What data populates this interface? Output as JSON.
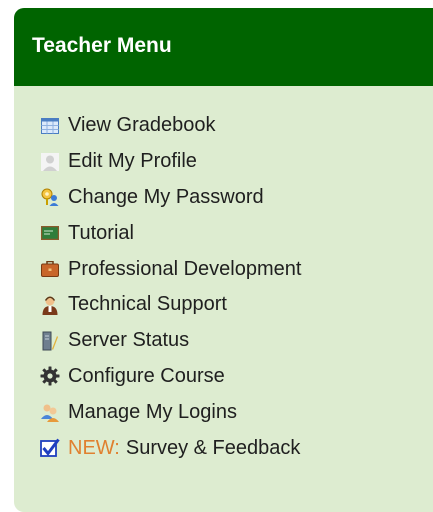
{
  "menu": {
    "title": "Teacher Menu",
    "items": [
      {
        "label": "View Gradebook",
        "icon": "gradebook-icon"
      },
      {
        "label": "Edit My Profile",
        "icon": "profile-icon"
      },
      {
        "label": "Change My Password",
        "icon": "password-icon"
      },
      {
        "label": "Tutorial",
        "icon": "tutorial-icon"
      },
      {
        "label": "Professional Development",
        "icon": "briefcase-icon"
      },
      {
        "label": "Technical Support",
        "icon": "support-icon"
      },
      {
        "label": "Server Status",
        "icon": "server-icon"
      },
      {
        "label": "Configure Course",
        "icon": "gear-icon"
      },
      {
        "label": "Manage My Logins",
        "icon": "logins-icon"
      },
      {
        "label": "Survey & Feedback",
        "prefix": "NEW:",
        "icon": "checkbox-icon"
      }
    ]
  },
  "colors": {
    "header": "#006400",
    "panel": "#ddecd0",
    "new_prefix": "#e0802f"
  }
}
